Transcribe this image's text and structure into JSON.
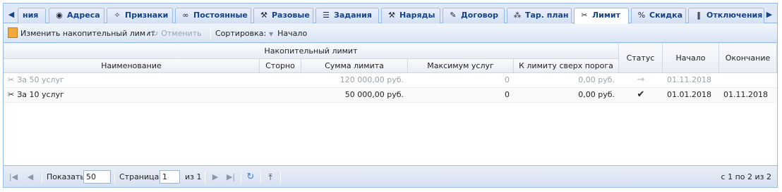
{
  "tabs": [
    {
      "label": "ния",
      "icon": "left-arrow-icon",
      "glyph": "🡄"
    },
    {
      "label": "Адреса",
      "icon": "map-pin-icon",
      "glyph": "📍"
    },
    {
      "label": "Признаки",
      "icon": "magic-wand-icon",
      "glyph": "✨"
    },
    {
      "label": "Постоянные",
      "icon": "link-icon",
      "glyph": "🔗"
    },
    {
      "label": "Разовые",
      "icon": "wrench-icon",
      "glyph": "🔧"
    },
    {
      "label": "Задания",
      "icon": "document-list-icon",
      "glyph": "📄"
    },
    {
      "label": "Наряды",
      "icon": "tools-icon",
      "glyph": "🛠"
    },
    {
      "label": "Договор",
      "icon": "contract-edit-icon",
      "glyph": "📝"
    },
    {
      "label": "Тар. план",
      "icon": "tariff-plan-icon",
      "glyph": "⁂"
    },
    {
      "label": "Лимит",
      "icon": "scissors-icon",
      "glyph": "✂"
    },
    {
      "label": "Скидка",
      "icon": "discount-icon",
      "glyph": "％"
    },
    {
      "label": "Отключения",
      "icon": "pause-icon",
      "glyph": "⏸"
    }
  ],
  "active_tab": "Лимит",
  "toolbar": {
    "edit_label": "Изменить накопительный лимит",
    "cancel_label": "Отменить",
    "sort_label": "Сортировка:",
    "sort_value": "Начало",
    "edit_icon": "edit-document-icon",
    "cancel_icon": "undo-icon",
    "sort_icon": "sort-down-icon"
  },
  "grid": {
    "group_header": "Накопительный лимит",
    "columns": [
      "Наименование",
      "Сторно",
      "Сумма лимита",
      "Максимум услуг",
      "К лимиту сверх порога",
      "Статус",
      "Начало",
      "Окончание"
    ],
    "rows": [
      {
        "name": "За 50 услуг",
        "storno": "",
        "limit_sum": "120 000,00 руб.",
        "max_services": "0",
        "over_threshold": "0,00 руб.",
        "status": "→",
        "status_icon": "arrow-right-icon",
        "start": "01.11.2018",
        "end": "",
        "inactive": true
      },
      {
        "name": "За 10 услуг",
        "storno": "",
        "limit_sum": "50 000,00 руб.",
        "max_services": "0",
        "over_threshold": "0,00 руб.",
        "status": "✔",
        "status_icon": "checkmark-icon",
        "start": "01.01.2018",
        "end": "01.11.2018",
        "inactive": false
      }
    ]
  },
  "pager": {
    "show_label": "Показать",
    "page_size": "50",
    "page_label": "Страница",
    "page_value": "1",
    "of_label": "из 1",
    "summary": "с 1 по 2 из 2"
  }
}
